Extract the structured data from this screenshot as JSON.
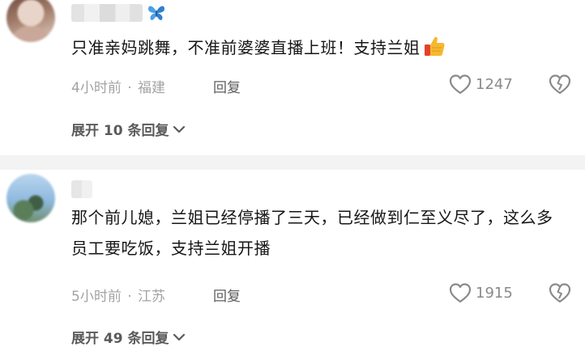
{
  "comments": [
    {
      "avatar_icon": "user-avatar-blurred",
      "username_icon": "butterfly-icon",
      "text": "只准亲妈跳舞，不准前婆婆直播上班！支持兰姐",
      "emoji_icon": "thumbs-up-icon",
      "time": "4小时前",
      "separator": "·",
      "location": "福建",
      "reply_label": "回复",
      "like_count": "1247",
      "expand_label": "展开 10 条回复"
    },
    {
      "avatar_icon": "user-avatar-blurred",
      "text": "那个前儿媳，兰姐已经停播了三天，已经做到仁至义尽了，这么多员工要吃饭，支持兰姐开播",
      "time": "5小时前",
      "separator": "·",
      "location": "江苏",
      "reply_label": "回复",
      "like_count": "1915",
      "expand_label": "展开 49 条回复"
    }
  ],
  "colors": {
    "text": "#161616",
    "meta": "#a3a3a3",
    "reply": "#5e5e5e",
    "expand": "#5a5a5a",
    "divider": "#f3f3f3",
    "butterfly": "#4a9fe8",
    "thumb": "#f5b82e"
  }
}
